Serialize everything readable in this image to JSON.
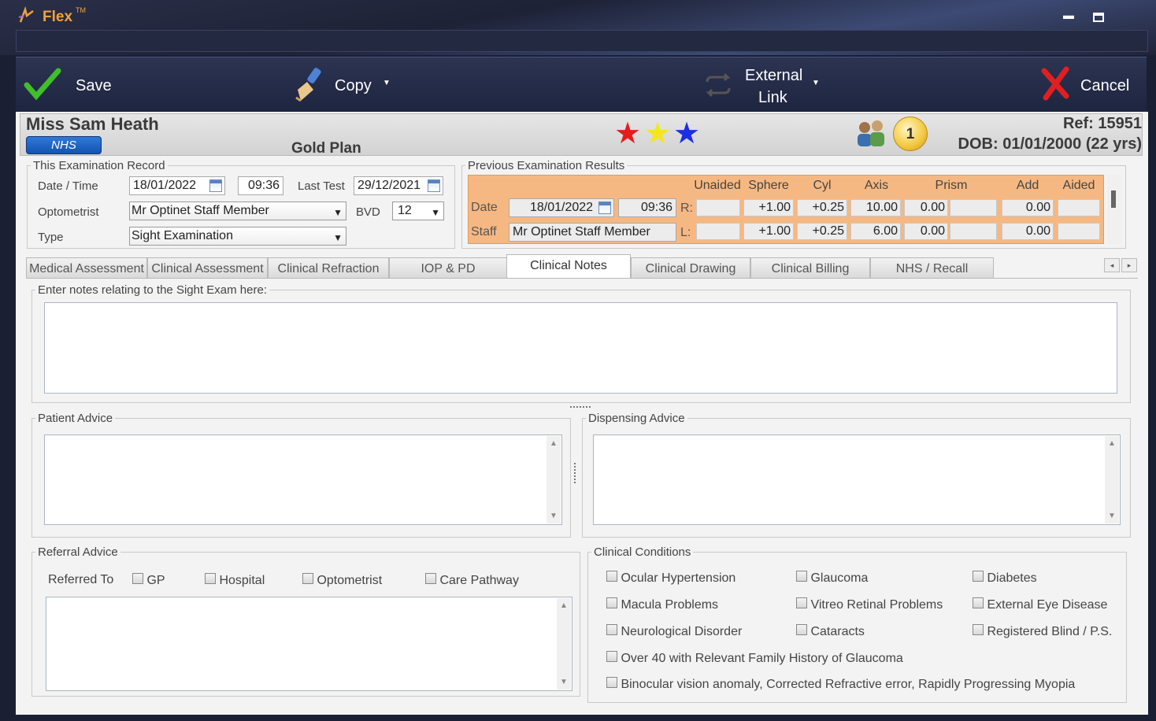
{
  "app": {
    "title": "Flex",
    "tm": "TM"
  },
  "toolbar": {
    "save": "Save",
    "copy": "Copy",
    "external_link_1": "External",
    "external_link_2": "Link",
    "cancel": "Cancel"
  },
  "patient": {
    "name": "Miss Sam Heath",
    "badge": "NHS",
    "plan": "Gold Plan",
    "ref": "Ref: 15951",
    "dob": "DOB: 01/01/2000 (22 yrs)",
    "count": "1",
    "stars": [
      "#e51c1c",
      "#f4e61a",
      "#1c2ee5"
    ]
  },
  "exam_record": {
    "legend": "This Examination Record",
    "date_label": "Date / Time",
    "date": "18/01/2022",
    "time": "09:36",
    "last_test_label": "Last Test",
    "last_test": "29/12/2021",
    "optometrist_label": "Optometrist",
    "optometrist": "Mr Optinet Staff Member",
    "bvd_label": "BVD",
    "bvd": "12",
    "type_label": "Type",
    "type": "Sight Examination"
  },
  "previous": {
    "legend": "Previous Examination Results",
    "headers": [
      "Unaided",
      "Sphere",
      "Cyl",
      "Axis",
      "Prism",
      "Add",
      "Aided"
    ],
    "date_label": "Date",
    "date": "18/01/2022",
    "time": "09:36",
    "staff_label": "Staff",
    "staff": "Mr Optinet Staff Member",
    "right_label": "R:",
    "left_label": "L:",
    "right": {
      "unaided": "",
      "sphere": "+1.00",
      "cyl": "+0.25",
      "axis": "10.00",
      "prism1": "0.00",
      "prism2": "",
      "add": "0.00",
      "aided": ""
    },
    "left": {
      "unaided": "",
      "sphere": "+1.00",
      "cyl": "+0.25",
      "axis": "6.00",
      "prism1": "0.00",
      "prism2": "",
      "add": "0.00",
      "aided": ""
    }
  },
  "tabs": [
    "Medical Assessment",
    "Clinical Assessment",
    "Clinical Refraction",
    "IOP & PD",
    "Clinical Notes",
    "Clinical Drawing",
    "Clinical Billing",
    "NHS / Recall"
  ],
  "notes": {
    "legend": "Enter notes relating to the Sight Exam here:",
    "text": ""
  },
  "patient_advice": {
    "legend": "Patient Advice",
    "text": ""
  },
  "dispensing_advice": {
    "legend": "Dispensing Advice",
    "text": ""
  },
  "referral": {
    "legend": "Referral Advice",
    "referred_to": "Referred To",
    "options": [
      "GP",
      "Hospital",
      "Optometrist",
      "Care Pathway"
    ],
    "text": ""
  },
  "conditions": {
    "legend": "Clinical Conditions",
    "items": [
      "Ocular Hypertension",
      "Glaucoma",
      "Diabetes",
      "Macula Problems",
      "Vitreo Retinal Problems",
      "External Eye Disease",
      "Neurological Disorder",
      "Cataracts",
      "Registered Blind / P.S.",
      "Over 40 with Relevant Family History of Glaucoma",
      "Binocular vision anomaly, Corrected Refractive error, Rapidly Progressing Myopia"
    ]
  }
}
